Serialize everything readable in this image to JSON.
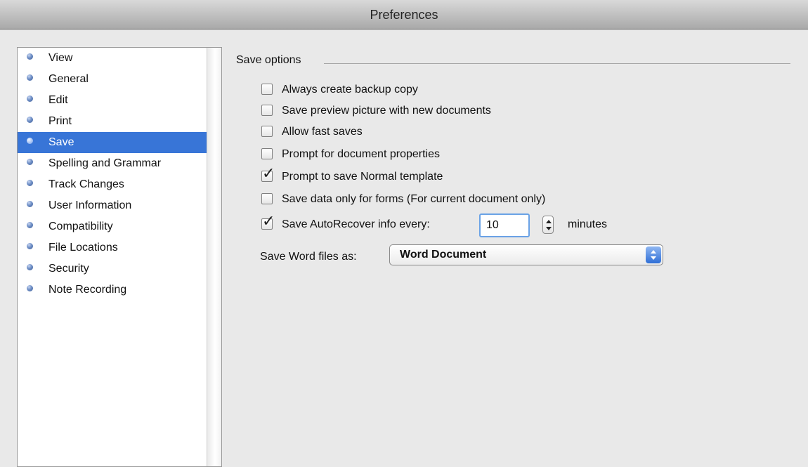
{
  "window": {
    "title": "Preferences"
  },
  "sidebar": {
    "items": [
      {
        "label": "View",
        "selected": false
      },
      {
        "label": "General",
        "selected": false
      },
      {
        "label": "Edit",
        "selected": false
      },
      {
        "label": "Print",
        "selected": false
      },
      {
        "label": "Save",
        "selected": true
      },
      {
        "label": "Spelling and Grammar",
        "selected": false
      },
      {
        "label": "Track Changes",
        "selected": false
      },
      {
        "label": "User Information",
        "selected": false
      },
      {
        "label": "Compatibility",
        "selected": false
      },
      {
        "label": "File Locations",
        "selected": false
      },
      {
        "label": "Security",
        "selected": false
      },
      {
        "label": "Note Recording",
        "selected": false
      }
    ]
  },
  "save_options": {
    "group_title": "Save options",
    "checkboxes": [
      {
        "label": "Always create backup copy",
        "checked": false
      },
      {
        "label": "Save preview picture with new documents",
        "checked": false
      },
      {
        "label": "Allow fast saves",
        "checked": false
      },
      {
        "label": "Prompt for document properties",
        "checked": false
      },
      {
        "label": "Prompt to save Normal template",
        "checked": true
      },
      {
        "label": "Save data only for forms (For current document only)",
        "checked": false
      },
      {
        "label": "Save AutoRecover info every:",
        "checked": true
      }
    ],
    "autorecover": {
      "value": "10",
      "unit_label": "minutes"
    },
    "save_as": {
      "label": "Save Word files as:",
      "selected": "Word Document"
    }
  },
  "colors": {
    "selection": "#3875d7",
    "focus_ring": "#6aa2e6"
  }
}
